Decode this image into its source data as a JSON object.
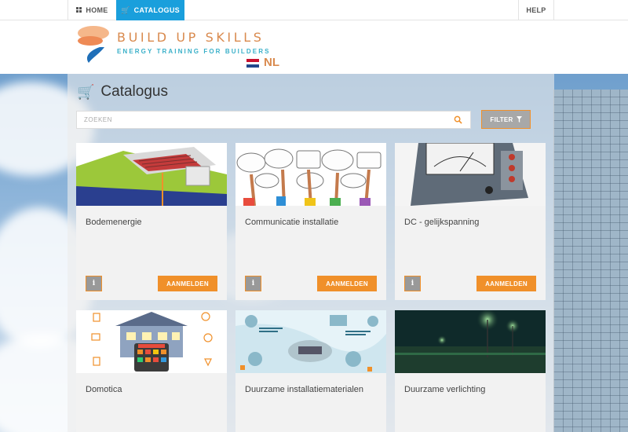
{
  "nav": {
    "home": "HOME",
    "catalogus": "CATALOGUS",
    "help": "HELP",
    "active_color": "#1a9fdc"
  },
  "logo": {
    "title": "BUILD UP SKILLS",
    "subtitle": "ENERGY TRAINING FOR BUILDERS",
    "country": "NL",
    "title_color": "#d98a4e",
    "subtitle_color": "#3ab0c9"
  },
  "catalog": {
    "title": "Catalogus",
    "search_placeholder": "ZOEKEN",
    "filter_label": "FILTER",
    "accent": "#f0902a",
    "info_label": "i",
    "register_label": "AANMELDEN"
  },
  "courses": [
    {
      "title": "Bodemenergie",
      "image": "geothermal-diagram"
    },
    {
      "title": "Communicatie installatie",
      "image": "speech-bubbles-crowd"
    },
    {
      "title": "DC - gelijkspanning",
      "image": "voltmeter"
    },
    {
      "title": "Domotica",
      "image": "smart-house"
    },
    {
      "title": "Duurzame installatiematerialen",
      "image": "installation-materials-infographic"
    },
    {
      "title": "Duurzame verlichting",
      "image": "green-street-lights-night"
    }
  ],
  "icons": {
    "home": "grid-icon",
    "catalogus": "cart-icon",
    "search": "search-icon",
    "filter": "funnel-icon"
  }
}
